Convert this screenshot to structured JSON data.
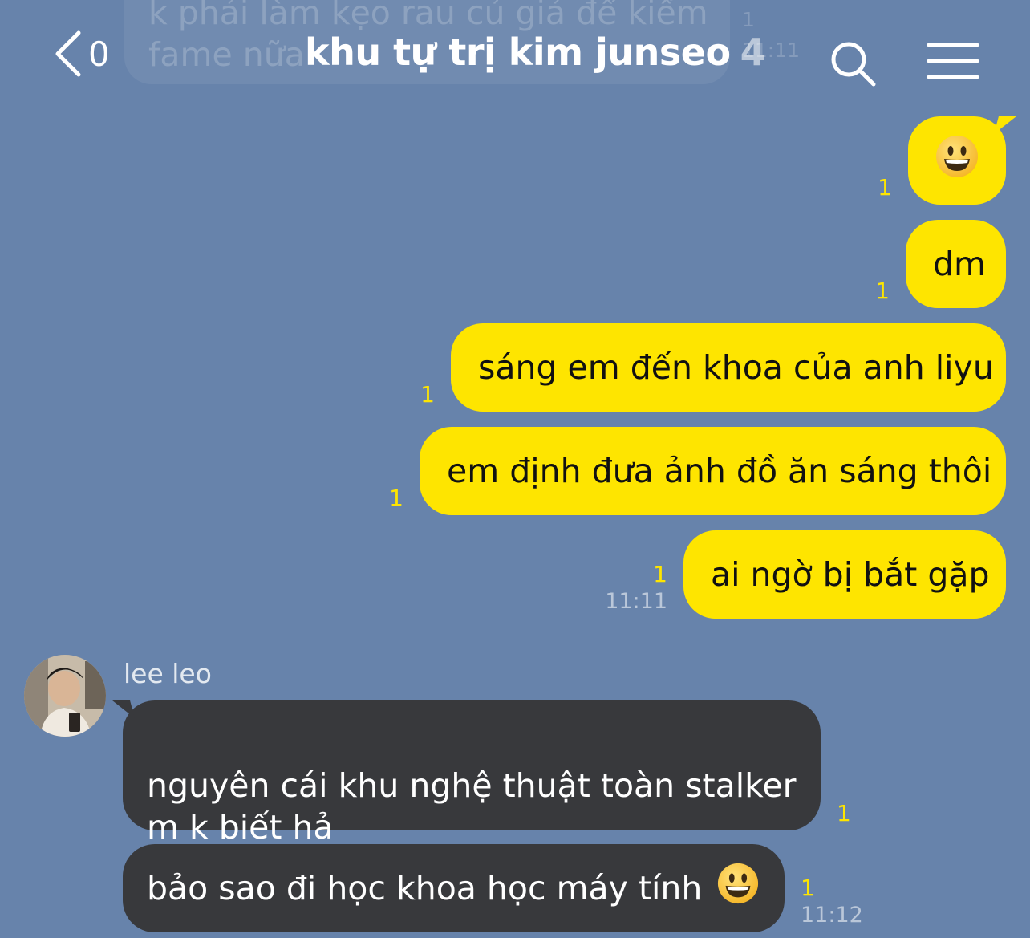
{
  "background_color": "#6783ab",
  "accent_color": "#fee500",
  "ghost": {
    "text": "k phải làm kẹo rau củ giả để kiếm\nfame nữa",
    "meta": "1\n11:11"
  },
  "header": {
    "back_count": "0",
    "title": "khu tự trị kim junseo",
    "member_count": "4",
    "icons": [
      "chevron-left-icon",
      "search-icon",
      "menu-icon"
    ]
  },
  "outgoing": [
    {
      "text": "😀",
      "unread": "1",
      "time": ""
    },
    {
      "text": "dm",
      "unread": "1",
      "time": ""
    },
    {
      "text": "sáng em đến khoa của anh liyu",
      "unread": "1",
      "time": ""
    },
    {
      "text": "em định đưa ảnh đồ ăn sáng thôi",
      "unread": "1",
      "time": ""
    },
    {
      "text": "ai ngờ bị bắt gặp",
      "unread": "1",
      "time": "11:11"
    }
  ],
  "incoming": {
    "sender": "lee leo",
    "messages": [
      {
        "text": "nguyên cái khu nghệ thuật toàn stalker\nm k biết hả",
        "unread": "1",
        "time": ""
      },
      {
        "text": "bảo sao đi học khoa học máy tính",
        "unread": "1",
        "time": "11:12"
      }
    ]
  }
}
